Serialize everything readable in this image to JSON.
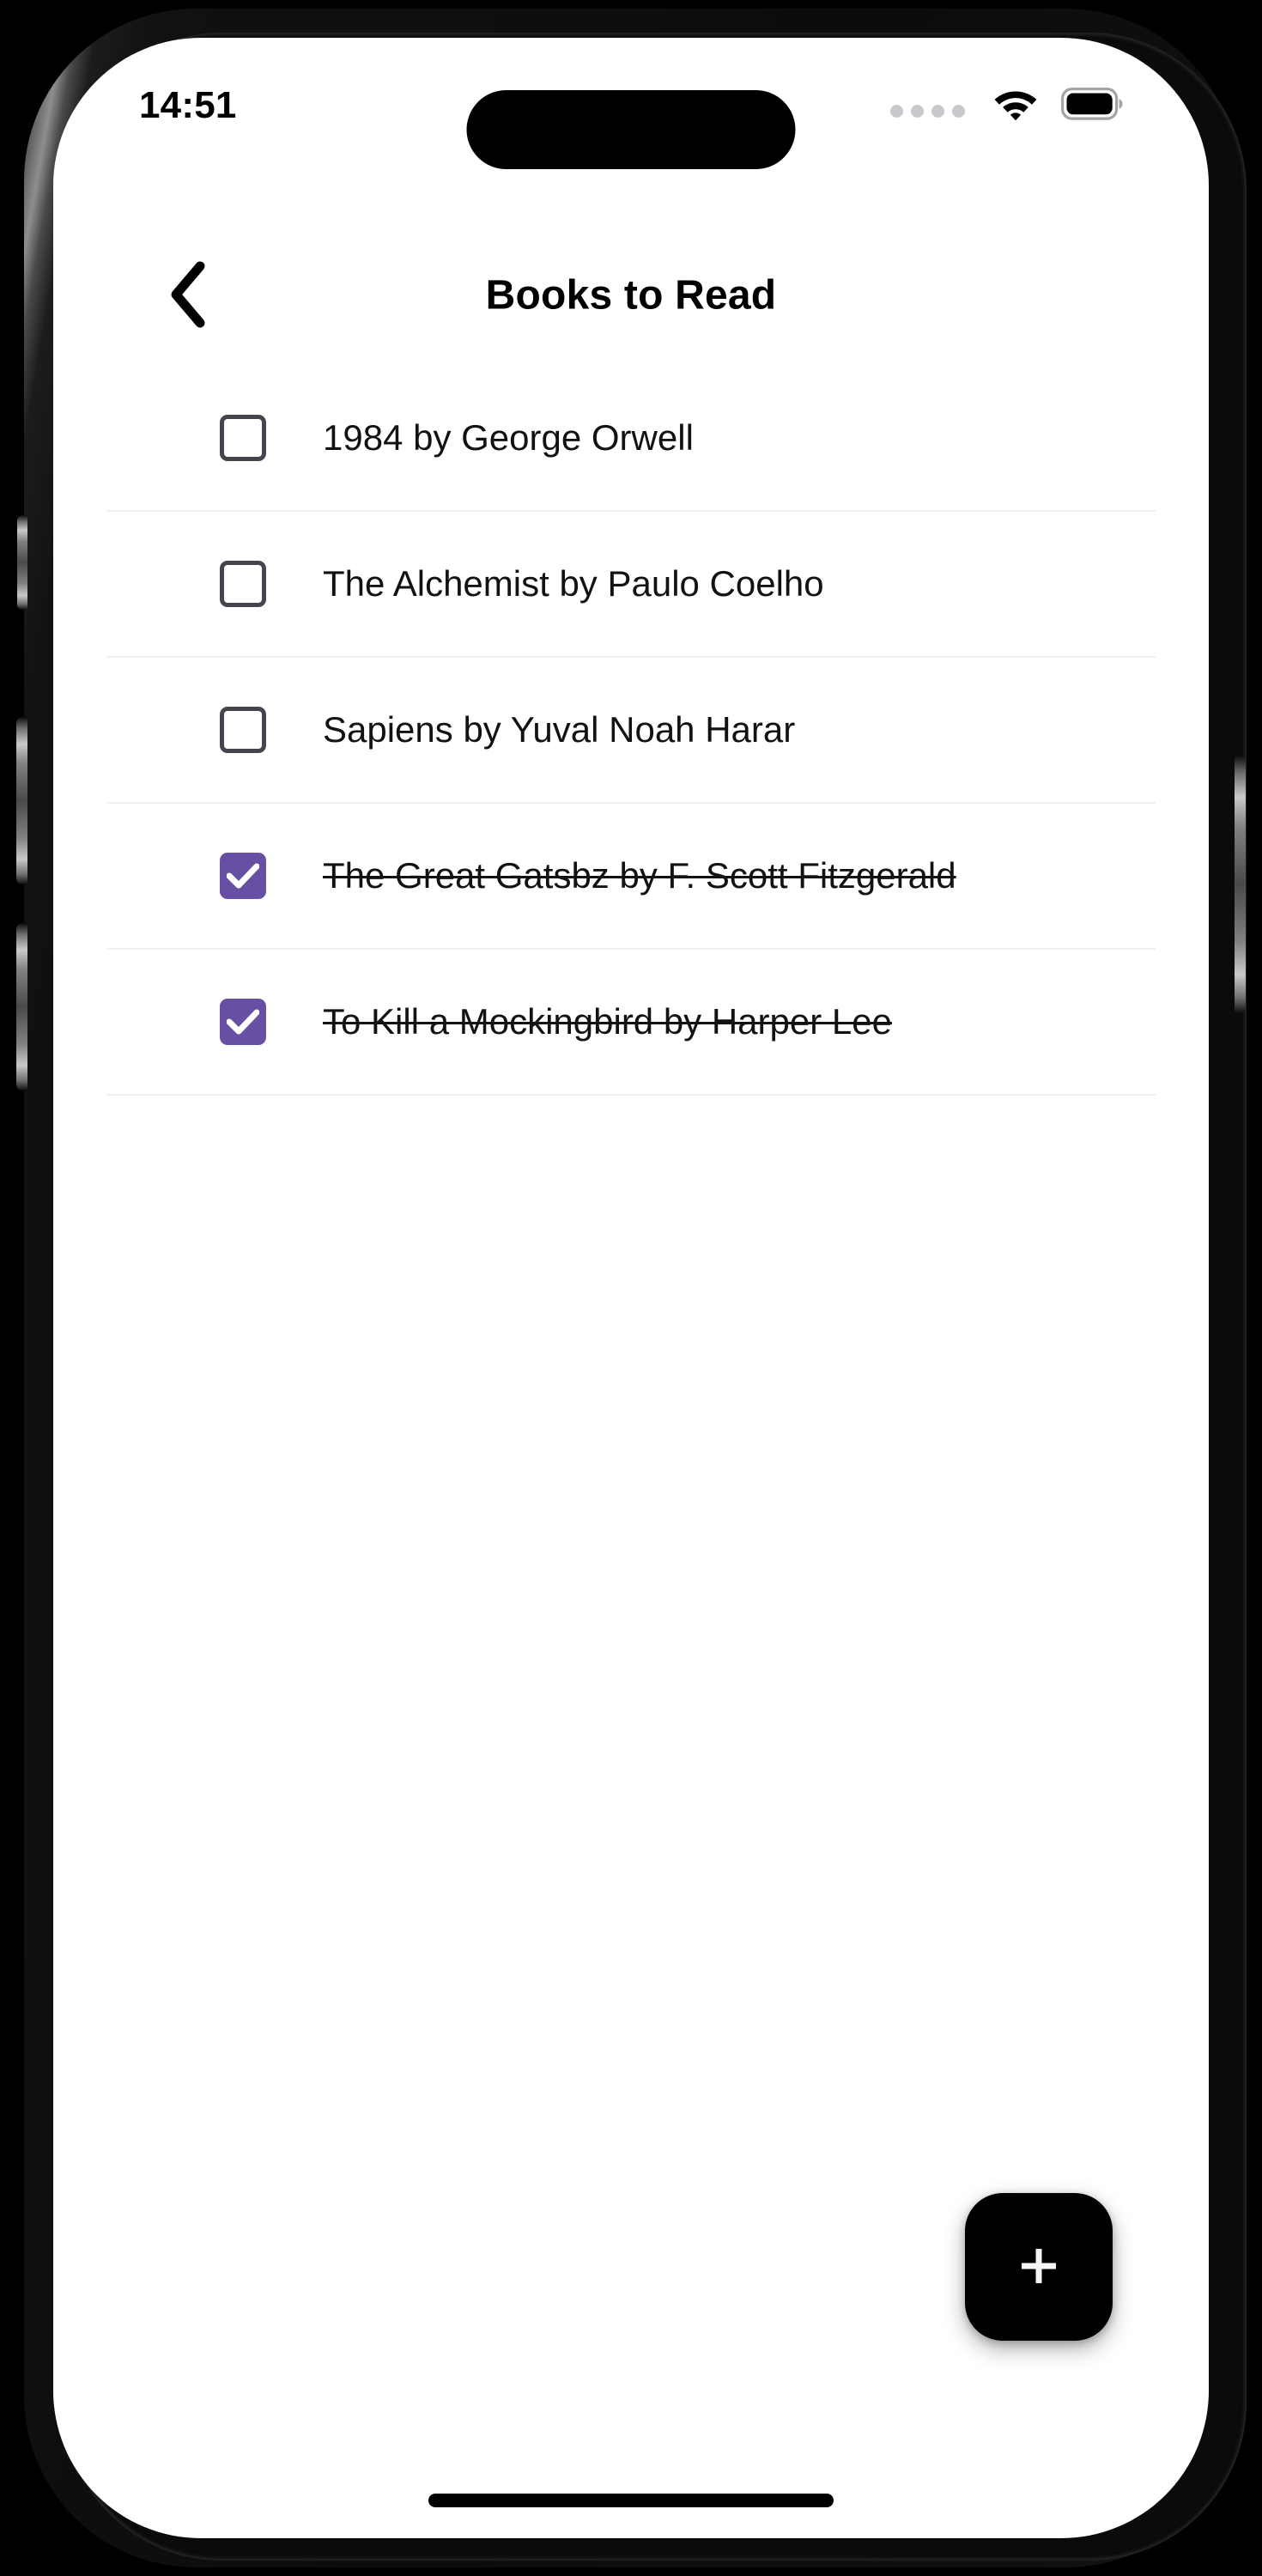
{
  "status_bar": {
    "time": "14:51",
    "signal_icon": "signal-dots-icon",
    "wifi_icon": "wifi-icon",
    "battery_icon": "battery-full-icon"
  },
  "header": {
    "back_icon": "chevron-left-icon",
    "title": "Books to Read"
  },
  "list": {
    "items": [
      {
        "label": "1984 by George Orwell",
        "checked": false
      },
      {
        "label": "The Alchemist by Paulo Coelho",
        "checked": false
      },
      {
        "label": "Sapiens by Yuval Noah Harar",
        "checked": false
      },
      {
        "label": "The Great Gatsbz by F. Scott Fitzgerald",
        "checked": true
      },
      {
        "label": "To Kill a Mockingbird by Harper Lee",
        "checked": true
      }
    ]
  },
  "fab": {
    "icon": "plus-icon",
    "label": "+"
  },
  "colors": {
    "accent_purple": "#6750A4",
    "checkbox_border": "#45454F",
    "divider": "#F0F0F2",
    "text": "#121212",
    "fab_background": "#000000"
  }
}
